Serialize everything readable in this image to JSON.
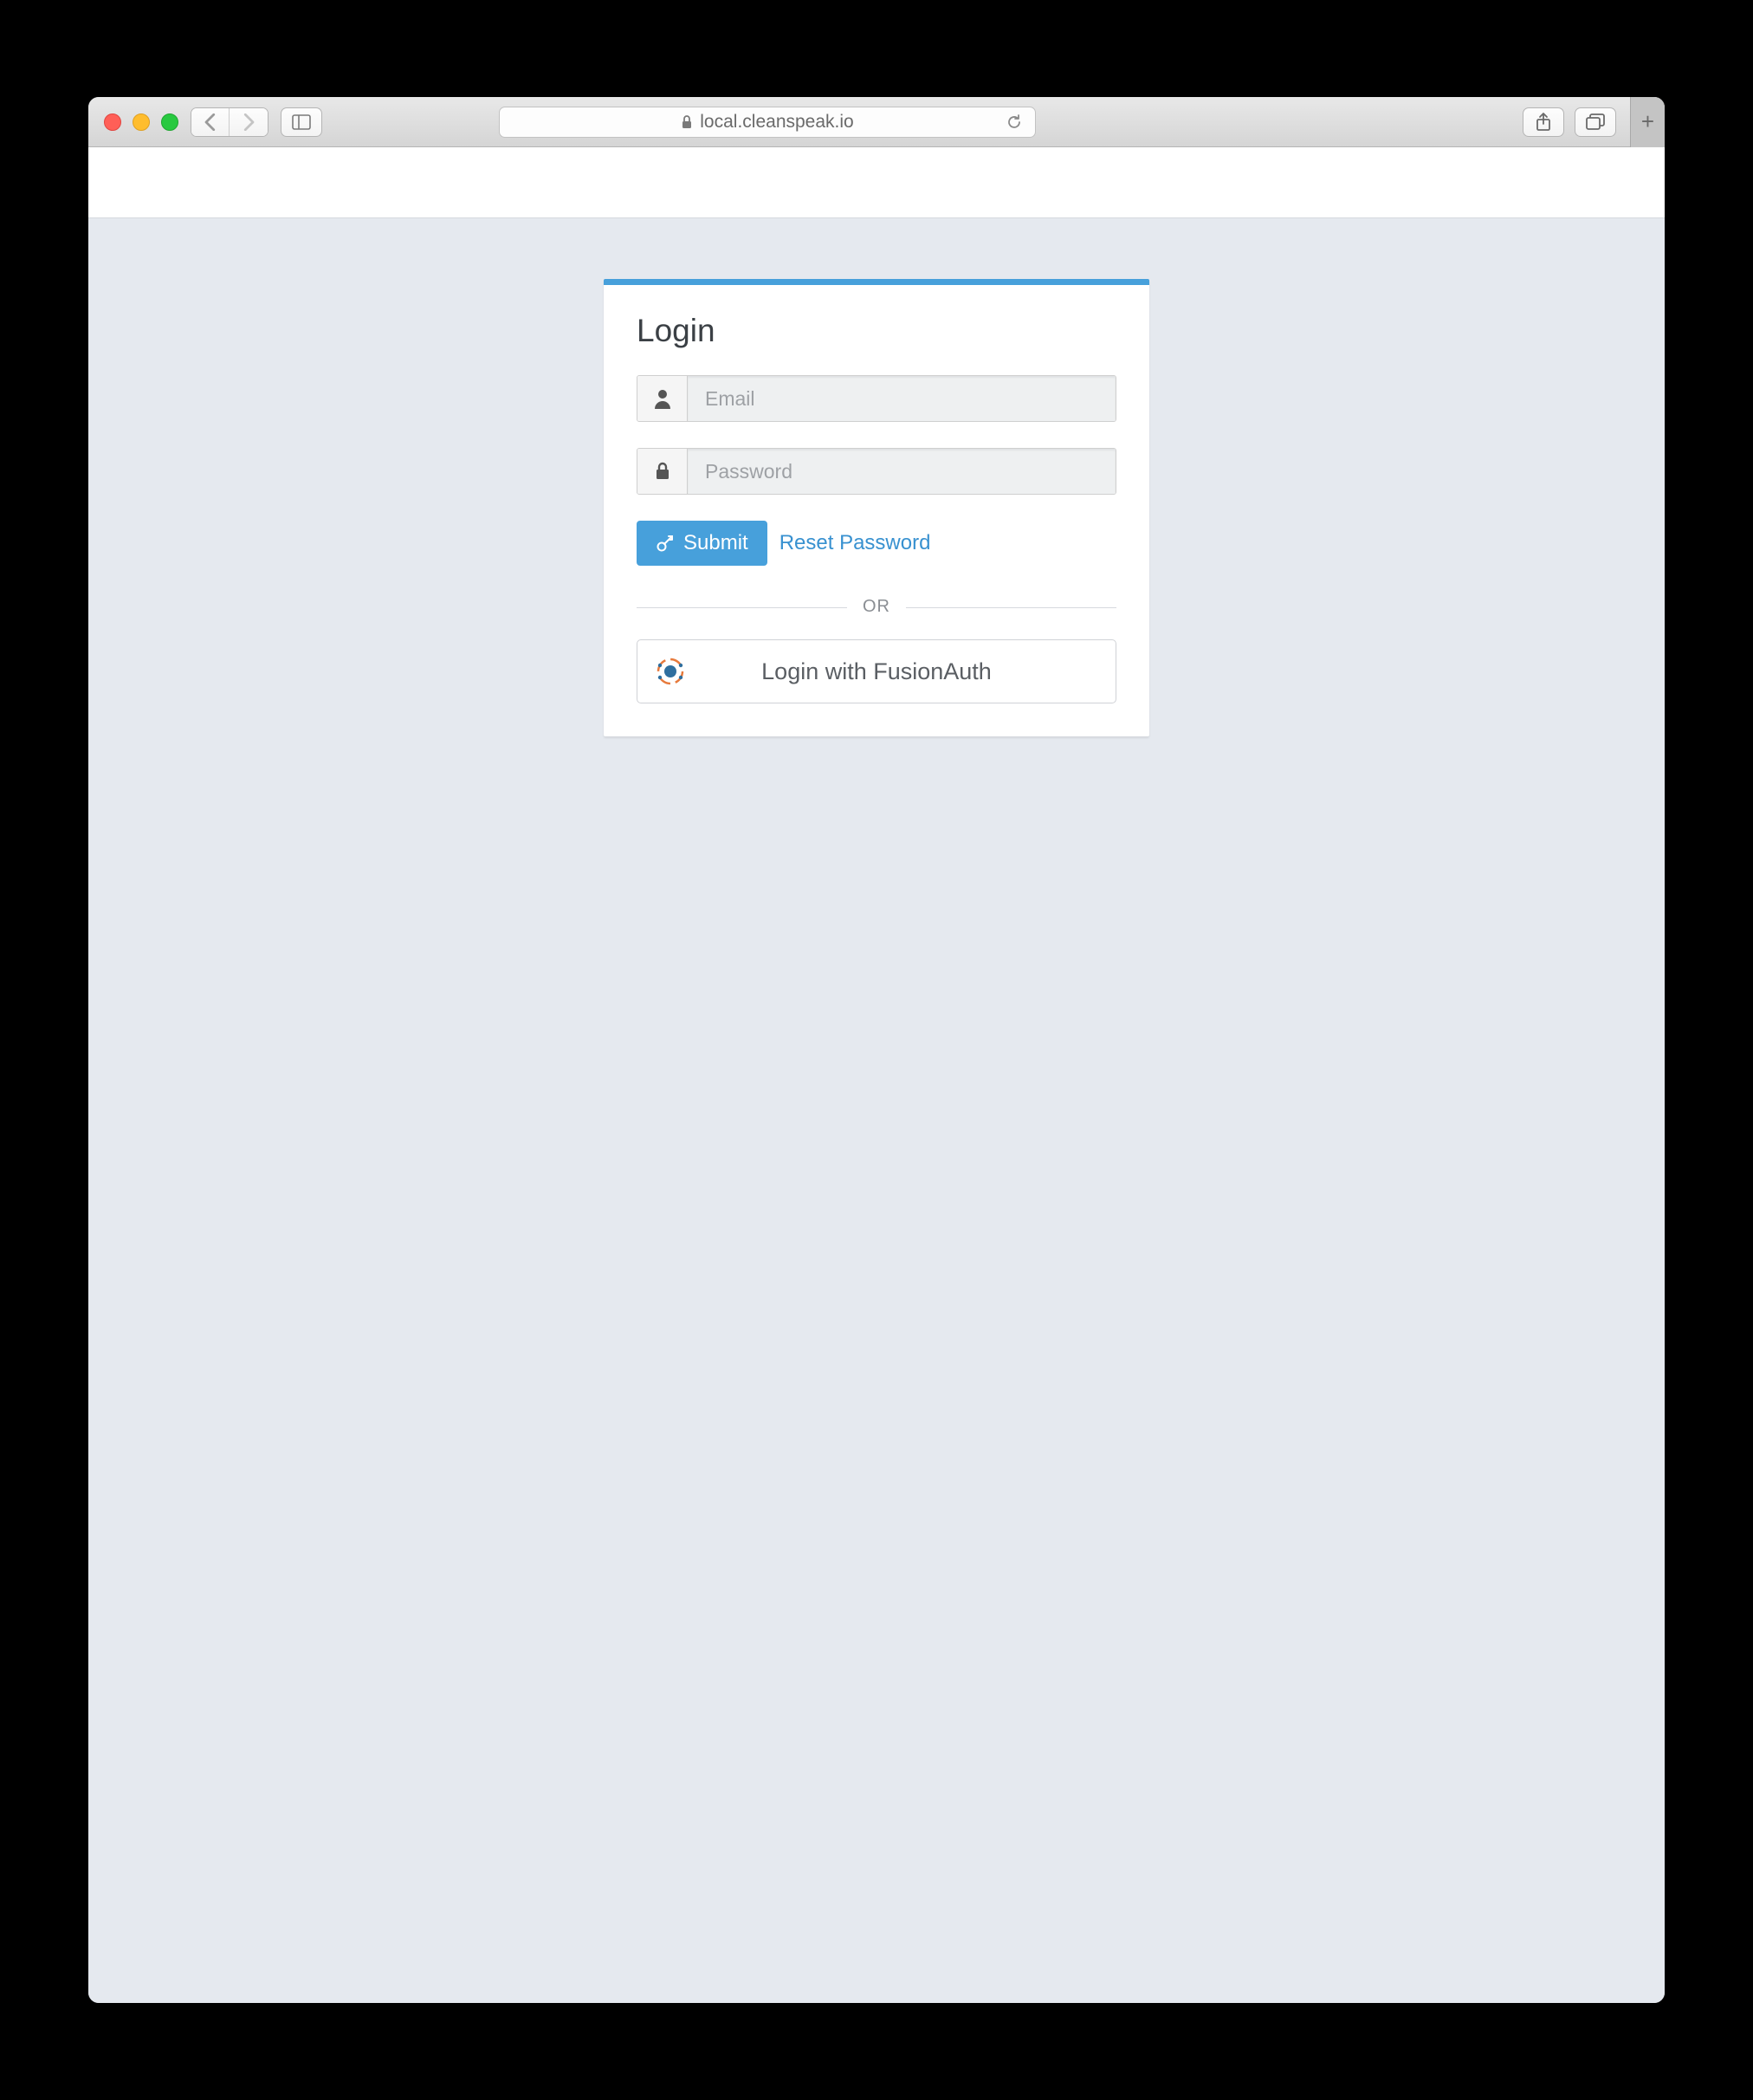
{
  "browser": {
    "url": "local.cleanspeak.io"
  },
  "page": {
    "title": "Login",
    "email": {
      "placeholder": "Email",
      "value": ""
    },
    "password": {
      "placeholder": "Password",
      "value": ""
    },
    "submit_label": "Submit",
    "reset_label": "Reset Password",
    "divider_label": "OR",
    "oauth_label": "Login with FusionAuth"
  }
}
